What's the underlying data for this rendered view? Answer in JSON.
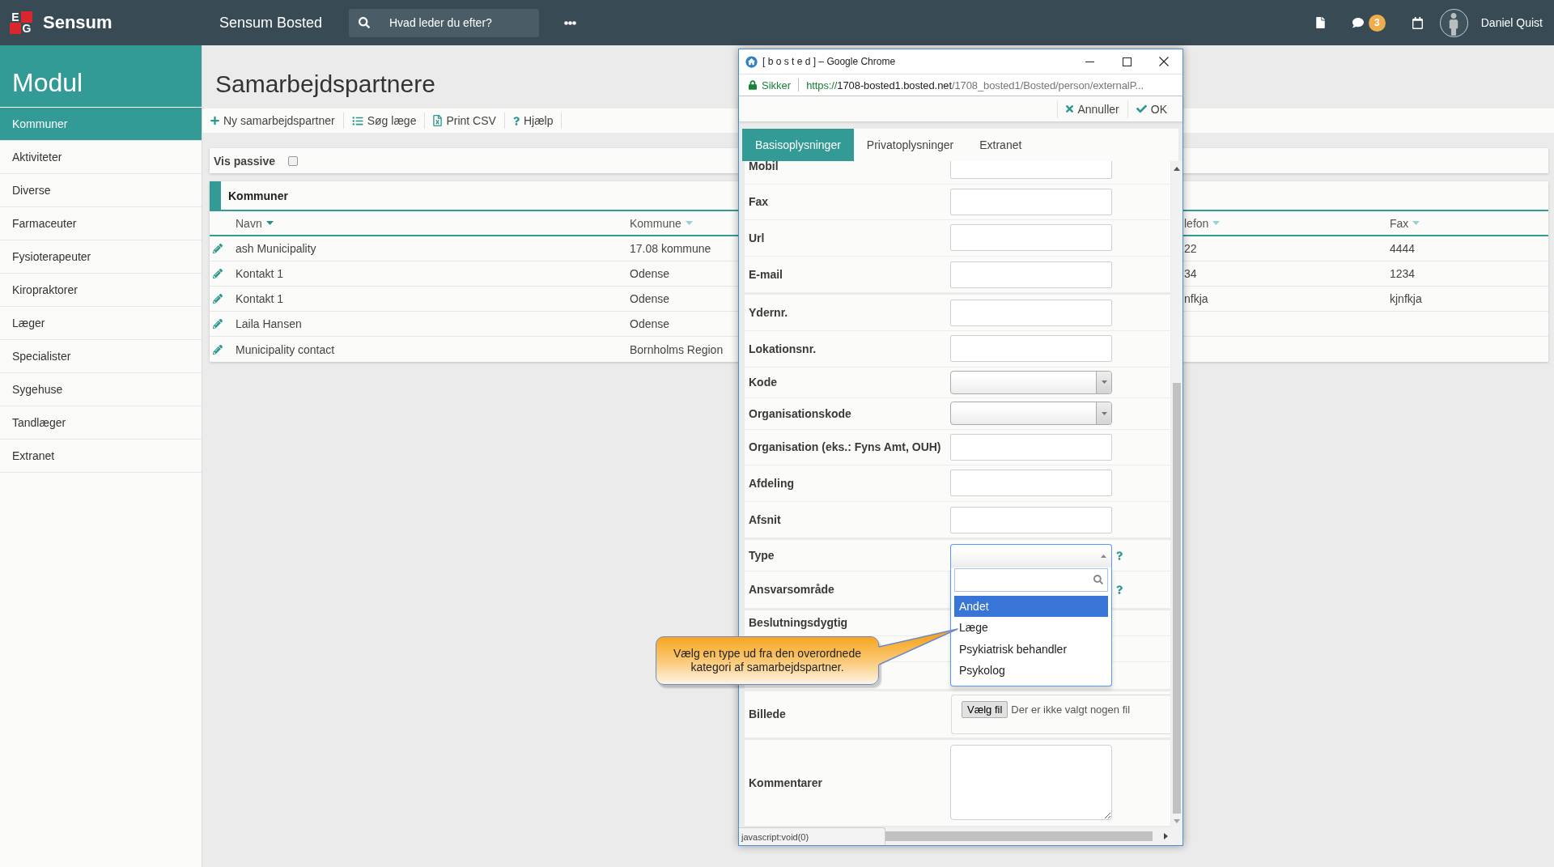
{
  "topbar": {
    "logo": {
      "letters": [
        "E",
        "G"
      ],
      "name": "Sensum"
    },
    "app_title": "Sensum Bosted",
    "search": {
      "placeholder": "Hvad leder du efter?"
    },
    "notifications": {
      "count": "3"
    },
    "user": {
      "name": "Daniel Quist"
    }
  },
  "sidebar": {
    "title": "Modul",
    "items": [
      {
        "label": "Kommuner",
        "selected": true
      },
      {
        "label": "Aktiviteter",
        "selected": false
      },
      {
        "label": "Diverse",
        "selected": false
      },
      {
        "label": "Farmaceuter",
        "selected": false
      },
      {
        "label": "Fysioterapeuter",
        "selected": false
      },
      {
        "label": "Kiropraktorer",
        "selected": false
      },
      {
        "label": "Læger",
        "selected": false
      },
      {
        "label": "Specialister",
        "selected": false
      },
      {
        "label": "Sygehuse",
        "selected": false
      },
      {
        "label": "Tandlæger",
        "selected": false
      },
      {
        "label": "Extranet",
        "selected": false
      }
    ]
  },
  "page": {
    "title": "Samarbejdspartnere",
    "toolbar": [
      {
        "kind": "add",
        "label": "Ny samarbejdspartner"
      },
      {
        "kind": "list",
        "label": "Søg læge"
      },
      {
        "kind": "csv",
        "label": "Print CSV"
      },
      {
        "kind": "help",
        "label": "Hjælp"
      }
    ],
    "filter": {
      "label": "Vis passive",
      "checked": false
    },
    "table": {
      "title": "Kommuner",
      "columns": [
        {
          "label": "Navn",
          "sorted": true
        },
        {
          "label": "Kommune",
          "sorted": false
        },
        {
          "label": "lefon",
          "sorted": false
        },
        {
          "label": "Fax",
          "sorted": false
        }
      ],
      "rows": [
        {
          "cells": [
            "ash Municipality",
            "17.08 kommune",
            "22",
            "4444"
          ]
        },
        {
          "cells": [
            "Kontakt 1",
            "Odense",
            "34",
            "1234"
          ]
        },
        {
          "cells": [
            "Kontakt 1",
            "Odense",
            "nfkja",
            "kjnfkja"
          ]
        },
        {
          "cells": [
            "Laila Hansen",
            "Odense"
          ]
        },
        {
          "cells": [
            "Municipality contact",
            "Bornholms Region"
          ]
        }
      ]
    }
  },
  "popup": {
    "title": "[ b o s t e d ] – Google Chrome",
    "security": "Sikker",
    "url": {
      "scheme": "https://",
      "host": "1708-bosted1.bosted.net",
      "path": "/1708_bosted1/Bosted/person/externalP..."
    },
    "actions": [
      {
        "kind": "cancel",
        "label": "Annuller"
      },
      {
        "kind": "ok",
        "label": "OK"
      }
    ],
    "tabs": [
      {
        "label": "Basisoplysninger",
        "selected": true
      },
      {
        "label": "Privatoplysninger",
        "selected": false
      },
      {
        "label": "Extranet",
        "selected": false
      }
    ],
    "form": {
      "groups": [
        {
          "fields": [
            {
              "label": "Mobil",
              "kind": "text"
            },
            {
              "label": "Fax",
              "kind": "text"
            },
            {
              "label": "Url",
              "kind": "text"
            },
            {
              "label": "E-mail",
              "kind": "text"
            }
          ]
        },
        {
          "fields": [
            {
              "label": "Ydernr.",
              "kind": "text"
            },
            {
              "label": "Lokationsnr.",
              "kind": "text"
            },
            {
              "label": "Kode",
              "kind": "select",
              "expanded": false
            },
            {
              "label": "Organisationskode",
              "kind": "select",
              "expanded": false
            },
            {
              "label": "Organisation (eks.: Fyns Amt, OUH)",
              "kind": "text"
            },
            {
              "label": "Afdeling",
              "kind": "text"
            },
            {
              "label": "Afsnit",
              "kind": "text"
            }
          ]
        },
        {
          "fields": [
            {
              "label": "Type",
              "kind": "select",
              "expanded": true,
              "help": true,
              "options": [
                {
                  "label": "Andet",
                  "selected": true
                },
                {
                  "label": "Læge",
                  "selected": false
                },
                {
                  "label": "Psykiatrisk behandler",
                  "selected": false
                },
                {
                  "label": "Psykolog",
                  "selected": false
                }
              ]
            },
            {
              "label": "Ansvarsområde",
              "kind": "label",
              "help": true
            }
          ]
        },
        {
          "fields": [
            {
              "label": "Beslutningsdygtig",
              "kind": "label"
            },
            {
              "kind": "blank"
            },
            {
              "kind": "blank"
            }
          ]
        },
        {
          "fields": [
            {
              "label": "Billede",
              "kind": "file",
              "button": "Vælg fil",
              "value": "Der er ikke valgt nogen fil"
            }
          ]
        },
        {
          "fields": [
            {
              "label": "Kommentarer",
              "kind": "textarea"
            }
          ]
        }
      ]
    },
    "tooltip": "Vælg en type ud fra den overordnede kategori af samarbejdspartner.",
    "status_text": "javascript:void(0)"
  }
}
